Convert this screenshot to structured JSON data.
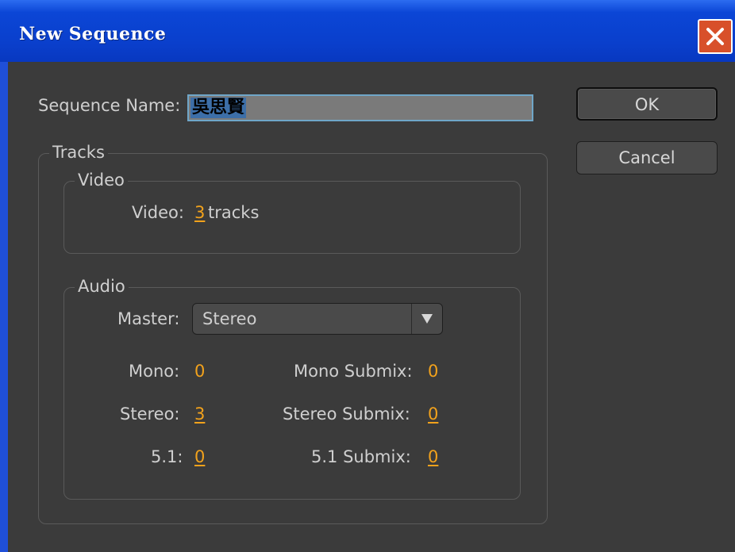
{
  "window": {
    "title": "New Sequence",
    "close_icon": "close-x-icon"
  },
  "sequence_name": {
    "label": "Sequence Name:",
    "value": "吳思賢"
  },
  "buttons": {
    "ok": "OK",
    "cancel": "Cancel"
  },
  "tracks": {
    "legend": "Tracks",
    "video": {
      "legend": "Video",
      "label": "Video:",
      "value": "3",
      "unit": "tracks"
    },
    "audio": {
      "legend": "Audio",
      "master_label": "Master:",
      "master_value": "Stereo",
      "dropdown_icon": "triangle-down-icon",
      "mono_label": "Mono:",
      "mono_value": "0",
      "stereo_label": "Stereo:",
      "stereo_value": "3",
      "surround_label": "5.1:",
      "surround_value": "0",
      "mono_submix_label": "Mono Submix:",
      "mono_submix_value": "0",
      "stereo_submix_label": "Stereo Submix:",
      "stereo_submix_value": "0",
      "surround_submix_label": "5.1 Submix:",
      "surround_submix_value": "0"
    }
  },
  "colors": {
    "titlebar": "#0a3fcc",
    "panel_bg": "#3b3b3b",
    "value_orange": "#f2a21c",
    "input_focus": "#6fa6c8",
    "close_red": "#d8502a"
  }
}
